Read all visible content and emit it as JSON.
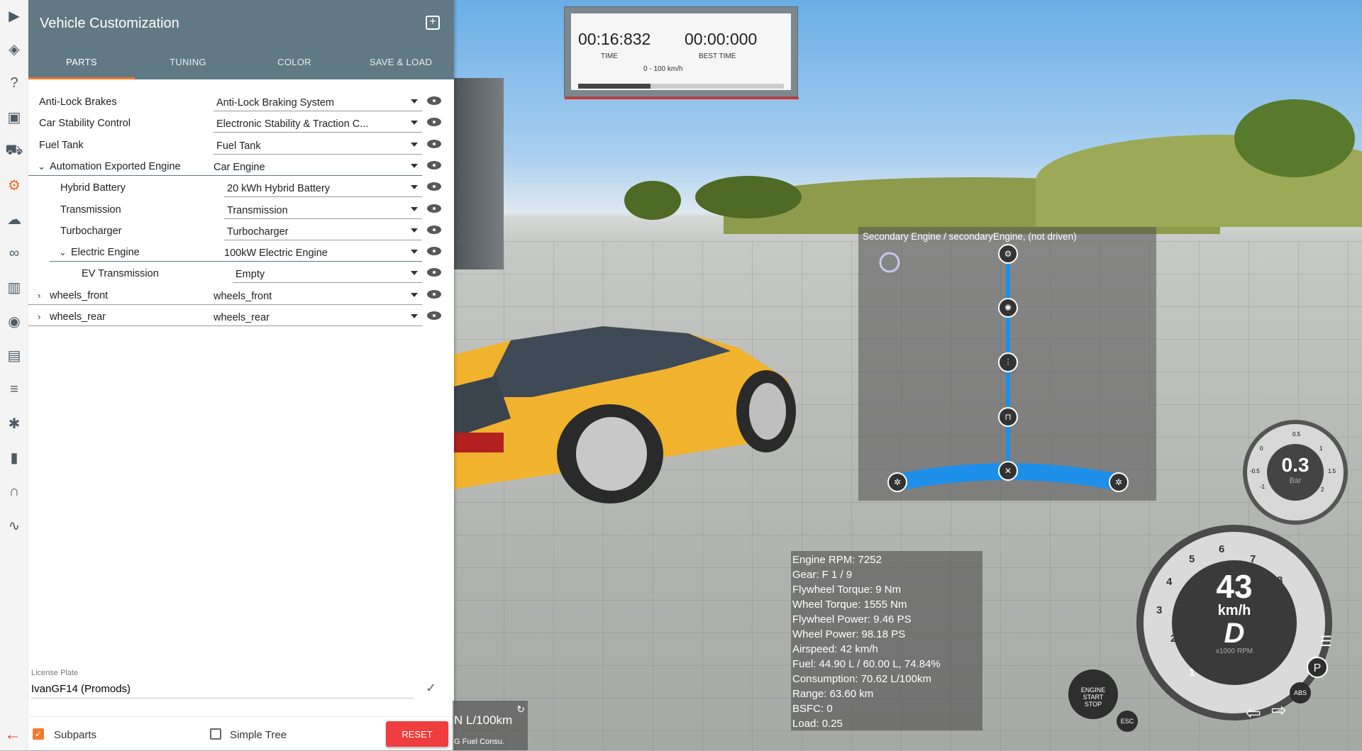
{
  "panel": {
    "title": "Vehicle Customization",
    "tabs": [
      {
        "label": "PARTS",
        "active": true
      },
      {
        "label": "TUNING",
        "active": false
      },
      {
        "label": "COLOR",
        "active": false
      },
      {
        "label": "SAVE & LOAD",
        "active": false
      }
    ],
    "parts": [
      {
        "label": "Anti-Lock Brakes",
        "value": "Anti-Lock Braking System",
        "level": 0,
        "expand": ""
      },
      {
        "label": "Car Stability Control",
        "value": "Electronic Stability & Traction C...",
        "level": 0,
        "expand": ""
      },
      {
        "label": "Fuel Tank",
        "value": "Fuel Tank",
        "level": 0,
        "expand": ""
      },
      {
        "label": "Automation Exported Engine",
        "value": "Car Engine",
        "level": 0,
        "expand": "open"
      },
      {
        "label": "Hybrid Battery",
        "value": "20 kWh Hybrid Battery",
        "level": 1,
        "expand": ""
      },
      {
        "label": "Transmission",
        "value": "Transmission",
        "level": 1,
        "expand": ""
      },
      {
        "label": "Turbocharger",
        "value": "Turbocharger",
        "level": 1,
        "expand": ""
      },
      {
        "label": "Electric Engine",
        "value": "100kW Electric Engine",
        "level": 1,
        "expand": "open"
      },
      {
        "label": "EV Transmission",
        "value": "Empty",
        "level": 2,
        "expand": ""
      },
      {
        "label": "wheels_front",
        "value": "wheels_front",
        "level": 0,
        "expand": "closed"
      },
      {
        "label": "wheels_rear",
        "value": "wheels_rear",
        "level": 0,
        "expand": "closed"
      }
    ],
    "license_plate_label": "License Plate",
    "license_plate_value": "IvanGF14 (Promods)",
    "subparts_label": "Subparts",
    "subparts_checked": true,
    "simple_tree_label": "Simple Tree",
    "simple_tree_checked": false,
    "reset_label": "RESET"
  },
  "timer": {
    "time_value": "00:16:832",
    "time_label": "TIME",
    "best_value": "00:00:000",
    "best_label": "BEST TIME",
    "range_label": "0 - 100 km/h",
    "progress": 0.35
  },
  "powertrain": {
    "title": "Secondary Engine / secondaryEngine, (not driven)"
  },
  "debug": [
    "Engine RPM: 7252",
    "Gear: F 1 / 9",
    "Flywheel Torque: 9 Nm",
    "Wheel Torque: 1555 Nm",
    "Flywheel Power: 9.46 PS",
    "Wheel Power: 98.18 PS",
    "Airspeed: 42 km/h",
    "Fuel: 44.90 L / 60.00 L, 74.84%",
    "Consumption: 70.62 L/100km",
    "Range: 63.60 km",
    "BSFC: 0",
    "Load: 0.25"
  ],
  "fuel_widget": {
    "value": "N L/100km",
    "label": "G Fuel Consu."
  },
  "boost": {
    "value": "0.3",
    "unit": "Bar",
    "ticks": [
      "-1",
      "-0.5",
      "0",
      "0.5",
      "1",
      "1.5",
      "2"
    ]
  },
  "speedo": {
    "speed": "43",
    "unit": "km/h",
    "gear": "D",
    "rpm_label": "x1000 RPM",
    "ticks": [
      "1",
      "2",
      "3",
      "4",
      "5",
      "6",
      "7",
      "8"
    ],
    "engine_button": [
      "ENGINE",
      "START",
      "STOP"
    ],
    "esc": "ESC",
    "abs": "ABS",
    "park": "P"
  },
  "icons": [
    "play-icon",
    "layers-icon",
    "help-icon",
    "video-icon",
    "car-icon",
    "gear-icon",
    "cloud-icon",
    "infinity-icon",
    "film-icon",
    "camera-icon",
    "window-icon",
    "sliders-icon",
    "bug-icon",
    "bar-chart-icon",
    "headphones-icon",
    "route-icon"
  ],
  "colors": {
    "header": "#607984",
    "accent": "#f07b2e",
    "reset": "#ef3e3e",
    "powertrain": "#1e8fe8"
  }
}
